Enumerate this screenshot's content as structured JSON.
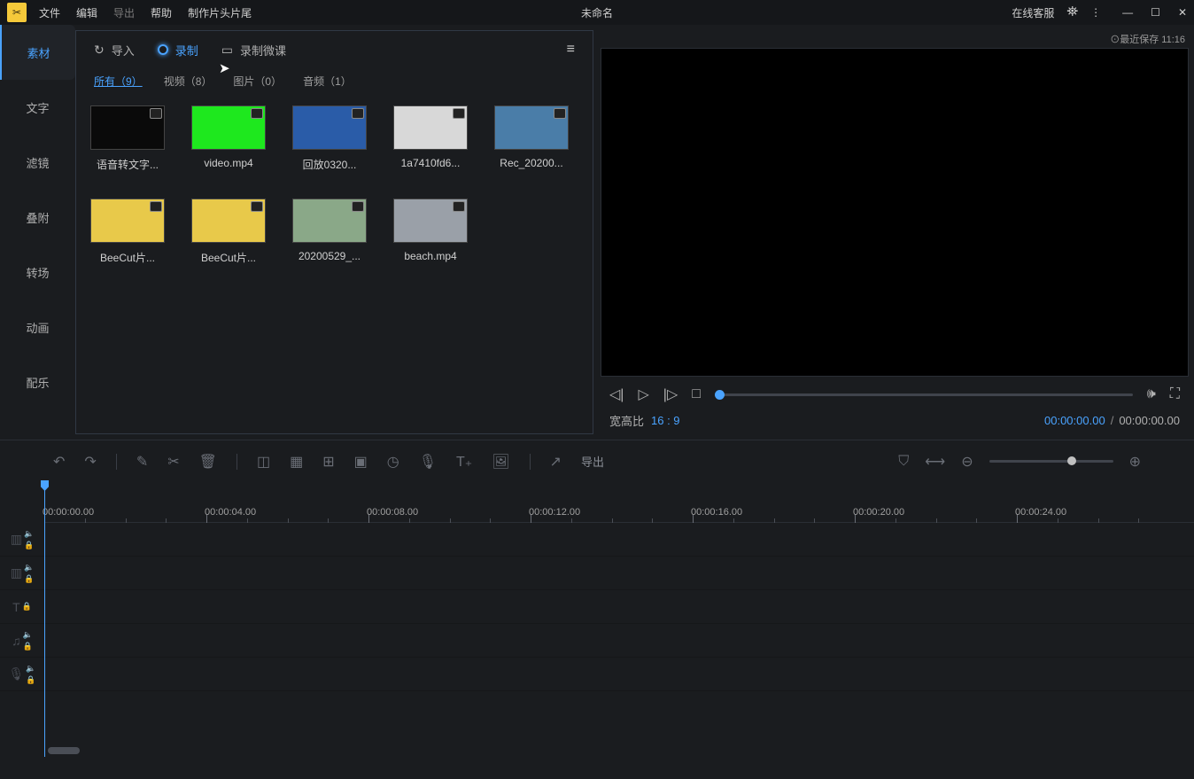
{
  "titlebar": {
    "menu": [
      "文件",
      "编辑",
      "导出",
      "帮助",
      "制作片头片尾"
    ],
    "title": "未命名",
    "online_service": "在线客服"
  },
  "save_status": "⊙最近保存 11:16",
  "sidebar": {
    "tabs": [
      "素材",
      "文字",
      "滤镜",
      "叠附",
      "转场",
      "动画",
      "配乐"
    ]
  },
  "media_toolbar": {
    "import": "导入",
    "record": "录制",
    "record_class": "录制微课"
  },
  "filter_tabs": [
    {
      "label": "所有（9）",
      "active": true
    },
    {
      "label": "视频（8）",
      "active": false
    },
    {
      "label": "图片（0）",
      "active": false
    },
    {
      "label": "音频（1）",
      "active": false
    }
  ],
  "media_items": [
    {
      "label": "语音转文字...",
      "thumb_bg": "#0a0a0a"
    },
    {
      "label": "video.mp4",
      "thumb_bg": "#1ee81e"
    },
    {
      "label": "回放0320...",
      "thumb_bg": "#2a5ca8"
    },
    {
      "label": "1a7410fd6...",
      "thumb_bg": "#d8d8d8"
    },
    {
      "label": "Rec_20200...",
      "thumb_bg": "#4a7da8"
    },
    {
      "label": "BeeCut片...",
      "thumb_bg": "#e8c94a"
    },
    {
      "label": "BeeCut片...",
      "thumb_bg": "#e8c94a"
    },
    {
      "label": "20200529_...",
      "thumb_bg": "#8aa888"
    },
    {
      "label": "beach.mp4",
      "thumb_bg": "#9aa0a8"
    }
  ],
  "preview": {
    "aspect_label": "宽高比",
    "aspect_value": "16 : 9",
    "time_current": "00:00:00.00",
    "time_total": "00:00:00.00"
  },
  "export_label": "导出",
  "ruler_labels": [
    "00:00:00.00",
    "00:00:04.00",
    "00:00:08.00",
    "00:00:12.00",
    "00:00:16.00",
    "00:00:20.00",
    "00:00:24.00"
  ]
}
